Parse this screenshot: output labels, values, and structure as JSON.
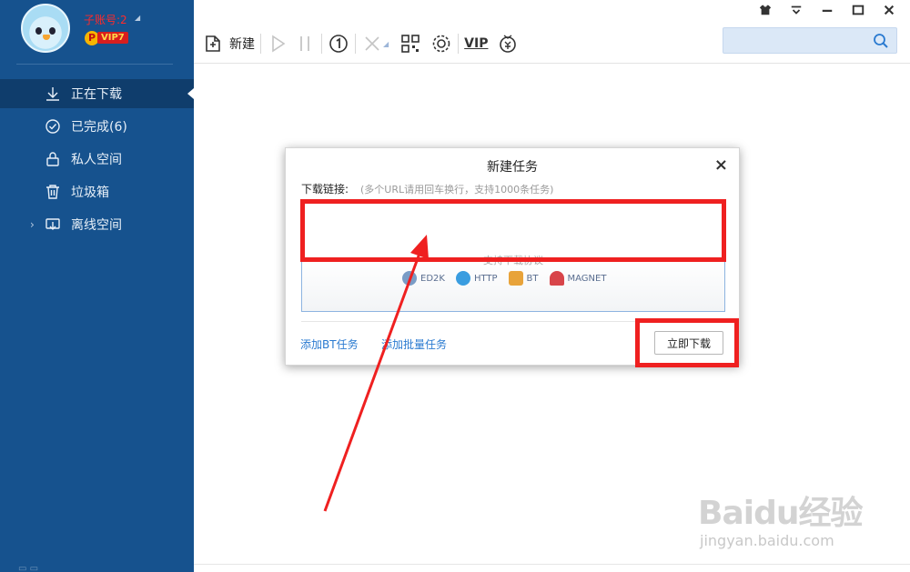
{
  "account": {
    "name": "子账号:2",
    "vip_level": "VIP7",
    "vip_p": "P"
  },
  "sidebar": {
    "items": [
      {
        "label": "正在下载",
        "icon": "download-icon",
        "active": true
      },
      {
        "label": "已完成(6)",
        "icon": "check-circle-icon"
      },
      {
        "label": "私人空间",
        "icon": "lock-icon"
      },
      {
        "label": "垃圾箱",
        "icon": "trash-icon"
      },
      {
        "label": "离线空间",
        "icon": "cloud-download-icon",
        "expandable": true
      }
    ]
  },
  "toolbar": {
    "new_label": "新建",
    "vip_label": "VIP"
  },
  "search": {
    "placeholder": ""
  },
  "dialog": {
    "title": "新建任务",
    "close": "×",
    "url_label": "下载链接:",
    "url_hint": "(多个URL请用回车换行，支持1000条任务)",
    "protocols_title": "支持下载协议",
    "protocols": [
      {
        "label": "ED2K",
        "icon": "ed2k-icon",
        "color": "#7a9cc6"
      },
      {
        "label": "HTTP",
        "icon": "http-icon",
        "color": "#3a9de0"
      },
      {
        "label": "BT",
        "icon": "bt-icon",
        "color": "#e8a33a"
      },
      {
        "label": "MAGNET",
        "icon": "magnet-icon",
        "color": "#d8454a"
      }
    ],
    "add_bt": "添加BT任务",
    "add_batch": "添加批量任务",
    "download_now": "立即下载"
  },
  "watermark": {
    "logo": "Baidu经验",
    "url": "jingyan.baidu.com"
  },
  "colors": {
    "sidebar": "#16528e",
    "annotation": "#ef2020",
    "link": "#2a7ad0"
  }
}
